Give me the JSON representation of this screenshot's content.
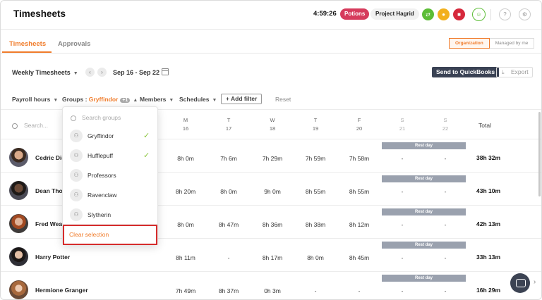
{
  "header": {
    "title": "Timesheets",
    "timer": "4:59:26",
    "activity": "Potions",
    "project": "Project Hagrid",
    "accent": "#f07c2b"
  },
  "tabs": {
    "active": "Timesheets",
    "inactive": "Approvals"
  },
  "view_toggle": {
    "organization": "Organization",
    "managed": "Managed by me"
  },
  "toolbar": {
    "view_label": "Weekly Timesheets",
    "date_range": "Sep 16 - Sep 22",
    "quickbooks": "Send to QuickBooks",
    "export": "Export"
  },
  "filters": {
    "payroll": "Payroll hours",
    "groups": "Groups",
    "groups_value": "Gryffindor",
    "groups_badge": "+1",
    "members": "Members",
    "schedules": "Schedules",
    "add_filter": "Add filter",
    "reset": "Reset"
  },
  "table": {
    "search_placeholder": "Search...",
    "total_label": "Total",
    "days": [
      {
        "dow": "M",
        "num": "16"
      },
      {
        "dow": "T",
        "num": "17"
      },
      {
        "dow": "W",
        "num": "18"
      },
      {
        "dow": "T",
        "num": "19"
      },
      {
        "dow": "F",
        "num": "20"
      },
      {
        "dow": "S",
        "num": "21"
      },
      {
        "dow": "S",
        "num": "22"
      }
    ],
    "rest_day_label": "Rest day",
    "rows": [
      {
        "name": "Cedric Dig",
        "cells": [
          "8h 0m",
          "7h 6m",
          "7h 29m",
          "7h 59m",
          "7h 58m",
          "-",
          "-"
        ],
        "total": "38h 32m"
      },
      {
        "name": "Dean Thor",
        "cells": [
          "8h 20m",
          "8h 0m",
          "9h 0m",
          "8h 55m",
          "8h 55m",
          "-",
          "-"
        ],
        "total": "43h 10m"
      },
      {
        "name": "Fred Weas",
        "cells": [
          "8h 0m",
          "8h 47m",
          "8h 36m",
          "8h 38m",
          "8h 12m",
          "-",
          "-"
        ],
        "total": "42h 13m"
      },
      {
        "name": "Harry Potter",
        "cells": [
          "8h 11m",
          "-",
          "8h 17m",
          "8h 0m",
          "8h 45m",
          "-",
          "-"
        ],
        "total": "33h 13m"
      },
      {
        "name": "Hermione Granger",
        "cells": [
          "7h 49m",
          "8h 37m",
          "0h 3m",
          "-",
          "-",
          "-",
          "-"
        ],
        "total": "16h 29m"
      }
    ]
  },
  "groups_dropdown": {
    "search_placeholder": "Search groups",
    "items": [
      {
        "label": "Gryffindor",
        "checked": true
      },
      {
        "label": "Hufflepuff",
        "checked": true
      },
      {
        "label": "Professors",
        "checked": false
      },
      {
        "label": "Ravenclaw",
        "checked": false
      },
      {
        "label": "Slytherin",
        "checked": false
      }
    ],
    "clear": "Clear selection"
  }
}
